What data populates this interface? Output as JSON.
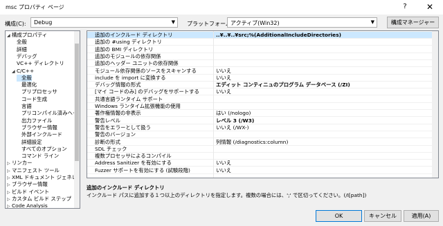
{
  "window": {
    "title": "msc プロパティ ページ",
    "help": "?",
    "close": "✕"
  },
  "config": {
    "config_label": "構成(C):",
    "config_value": "Debug",
    "platform_label": "プラットフォーム(P):",
    "platform_value": "アクティブ(Win32)",
    "manager_label": "構成マネージャー(O)..."
  },
  "tree": {
    "items": [
      {
        "label": "構成プロパティ",
        "expander": "◢",
        "selected": false
      },
      {
        "label": "全般",
        "expander": "",
        "selected": false
      },
      {
        "label": "詳細",
        "expander": "",
        "selected": false
      },
      {
        "label": "デバッグ",
        "expander": "",
        "selected": false
      },
      {
        "label": "VC++ ディレクトリ",
        "expander": "",
        "selected": false
      },
      {
        "label": "C/C++",
        "expander": "◢",
        "selected": false
      },
      {
        "label": "全般",
        "expander": "",
        "selected": true
      },
      {
        "label": "最適化",
        "expander": "",
        "selected": false
      },
      {
        "label": "プリプロセッサ",
        "expander": "",
        "selected": false
      },
      {
        "label": "コード生成",
        "expander": "",
        "selected": false
      },
      {
        "label": "言語",
        "expander": "",
        "selected": false
      },
      {
        "label": "プリコンパイル済みヘッダー",
        "expander": "",
        "selected": false
      },
      {
        "label": "出力ファイル",
        "expander": "",
        "selected": false
      },
      {
        "label": "ブラウザー情報",
        "expander": "",
        "selected": false
      },
      {
        "label": "外部インクルード",
        "expander": "",
        "selected": false
      },
      {
        "label": "詳細設定",
        "expander": "",
        "selected": false
      },
      {
        "label": "すべてのオプション",
        "expander": "",
        "selected": false
      },
      {
        "label": "コマンド ライン",
        "expander": "",
        "selected": false
      },
      {
        "label": "リンカー",
        "expander": "▷",
        "selected": false
      },
      {
        "label": "マニフェスト ツール",
        "expander": "▷",
        "selected": false
      },
      {
        "label": "XML ドキュメント ジェネレーター",
        "expander": "▷",
        "selected": false
      },
      {
        "label": "ブラウザー情報",
        "expander": "▷",
        "selected": false
      },
      {
        "label": "ビルド イベント",
        "expander": "▷",
        "selected": false
      },
      {
        "label": "カスタム ビルド ステップ",
        "expander": "▷",
        "selected": false
      },
      {
        "label": "Code Analysis",
        "expander": "▷",
        "selected": false
      }
    ]
  },
  "grid": {
    "rows": [
      {
        "name": "追加のインクルード ディレクトリ",
        "value": "..¥..¥..¥src;%(AdditionalIncludeDirectories)",
        "bold": true,
        "selected": true
      },
      {
        "name": "追加の #using ディレクトリ",
        "value": "",
        "bold": false,
        "selected": false
      },
      {
        "name": "追加の BMI ディレクトリ",
        "value": "",
        "bold": false,
        "selected": false
      },
      {
        "name": "追加のモジュールの依存関係",
        "value": "",
        "bold": false,
        "selected": false
      },
      {
        "name": "追加のヘッダー ユニットの依存関係",
        "value": "",
        "bold": false,
        "selected": false
      },
      {
        "name": "モジュール依存関係のソースをスキャンする",
        "value": "いいえ",
        "bold": false,
        "selected": false
      },
      {
        "name": "include を import に変換する",
        "value": "いいえ",
        "bold": false,
        "selected": false
      },
      {
        "name": "デバッグ情報の形式",
        "value": "エディット コンティニュのプログラム データベース (/ZI)",
        "bold": true,
        "selected": false
      },
      {
        "name": "[マイ コードのみ] のデバッグをサポートする",
        "value": "いいえ",
        "bold": false,
        "selected": false
      },
      {
        "name": "共通言語ランタイム サポート",
        "value": "",
        "bold": false,
        "selected": false
      },
      {
        "name": "Windows ランタイム拡張機能の使用",
        "value": "",
        "bold": false,
        "selected": false
      },
      {
        "name": "著作権情報の非表示",
        "value": "はい (/nologo)",
        "bold": false,
        "selected": false
      },
      {
        "name": "警告レベル",
        "value": "レベル 3 (/W3)",
        "bold": true,
        "selected": false
      },
      {
        "name": "警告をエラーとして扱う",
        "value": "いいえ (/WX-)",
        "bold": false,
        "selected": false
      },
      {
        "name": "警告のバージョン",
        "value": "",
        "bold": false,
        "selected": false
      },
      {
        "name": "診断の形式",
        "value": "列情報 (/diagnostics:column)",
        "bold": false,
        "selected": false
      },
      {
        "name": "SDL チェック",
        "value": "",
        "bold": false,
        "selected": false
      },
      {
        "name": "複数プロセッサによるコンパイル",
        "value": "",
        "bold": false,
        "selected": false
      },
      {
        "name": "Address Sanitizer を有効にする",
        "value": "いいえ",
        "bold": false,
        "selected": false
      },
      {
        "name": "Fuzzer サポートを有効にする (試験段階)",
        "value": "いいえ",
        "bold": false,
        "selected": false
      }
    ]
  },
  "description": {
    "title": "追加のインクルード ディレクトリ",
    "text": "インクルード パスに追加する１つ以上のディレクトリを指定します。複数の場合には、';' で区切ってください。(/I[path])"
  },
  "footer": {
    "ok": "OK",
    "cancel": "キャンセル",
    "apply": "適用(A)"
  },
  "colors": {
    "selection": "#cce8ff",
    "accent": "#0078d7"
  }
}
